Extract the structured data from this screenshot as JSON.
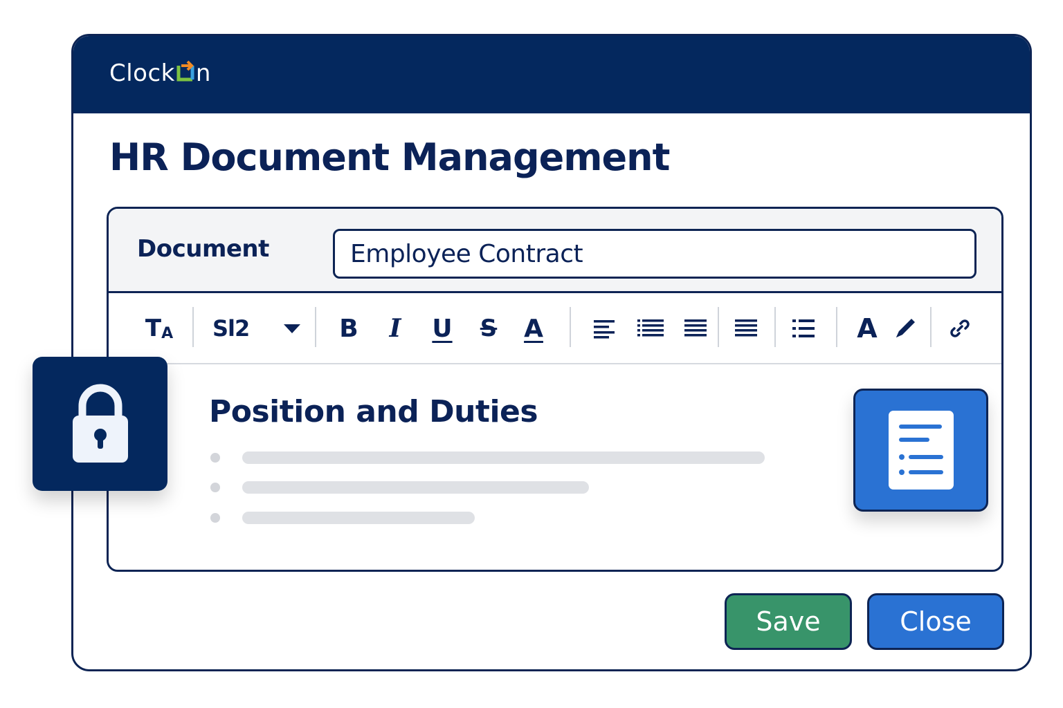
{
  "app": {
    "logo_text": "ClockOn",
    "logo_prefix": "Clock",
    "logo_suffix": "n"
  },
  "page": {
    "title": "HR Document Management"
  },
  "document": {
    "label": "Document",
    "value": "Employee Contract"
  },
  "toolbar": {
    "text_style_icon": "T",
    "text_style_sub": "A",
    "font_size_label": "Sl2",
    "bold": "B",
    "italic": "I",
    "underline": "U",
    "strikethrough": "S",
    "font_color": "A",
    "text_color_large": "A",
    "icons": [
      "text-style-icon",
      "font-size-dropdown",
      "bold-icon",
      "italic-icon",
      "underline-icon",
      "strikethrough-icon",
      "font-color-icon",
      "align-left-icon",
      "bulleted-list-icon",
      "align-justify-icon",
      "align-full-icon",
      "list-icon",
      "text-color-icon",
      "pen-icon",
      "link-icon"
    ]
  },
  "content": {
    "section_title": "Position and Duties",
    "bullet_count": 3
  },
  "actions": {
    "save_label": "Save",
    "close_label": "Close"
  },
  "colors": {
    "header_bg": "#04285e",
    "navy": "#0b2257",
    "save_green": "#38946a",
    "close_blue": "#2a72d3",
    "logo_green": "#7cc242",
    "logo_blue": "#3aa1e0",
    "logo_orange": "#f08a24"
  },
  "decor_icons": [
    "lock-icon",
    "document-list-icon"
  ]
}
